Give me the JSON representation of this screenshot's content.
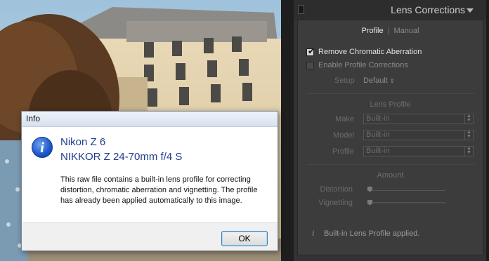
{
  "dialog": {
    "title": "Info",
    "camera": "Nikon Z 6",
    "lens": "NIKKOR Z 24-70mm f/4 S",
    "message": "This raw file contains a built-in lens profile for correcting distortion, chromatic aberration and vignetting. The profile has already been applied automatically to this image.",
    "ok_label": "OK"
  },
  "panel": {
    "title": "Lens Corrections",
    "tabs": {
      "profile": "Profile",
      "manual": "Manual"
    },
    "remove_ca": {
      "label": "Remove Chromatic Aberration",
      "checked": true
    },
    "enable_profile": {
      "label": "Enable Profile Corrections",
      "checked": false
    },
    "setup": {
      "label": "Setup",
      "value": "Default"
    },
    "lens_profile": {
      "title": "Lens Profile",
      "make": {
        "label": "Make",
        "value": "Built-in"
      },
      "model": {
        "label": "Model",
        "value": "Built-in"
      },
      "profile": {
        "label": "Profile",
        "value": "Built-in"
      }
    },
    "amount": {
      "title": "Amount",
      "distortion": {
        "label": "Distortion",
        "level": 0
      },
      "vignetting": {
        "label": "Vignetting",
        "level": 0
      }
    },
    "status": "Built-in Lens Profile applied."
  },
  "colors": {
    "panel_bg": "#333333",
    "dialog_heading": "#1f3d8f",
    "ok_border": "#3c7fb1"
  }
}
